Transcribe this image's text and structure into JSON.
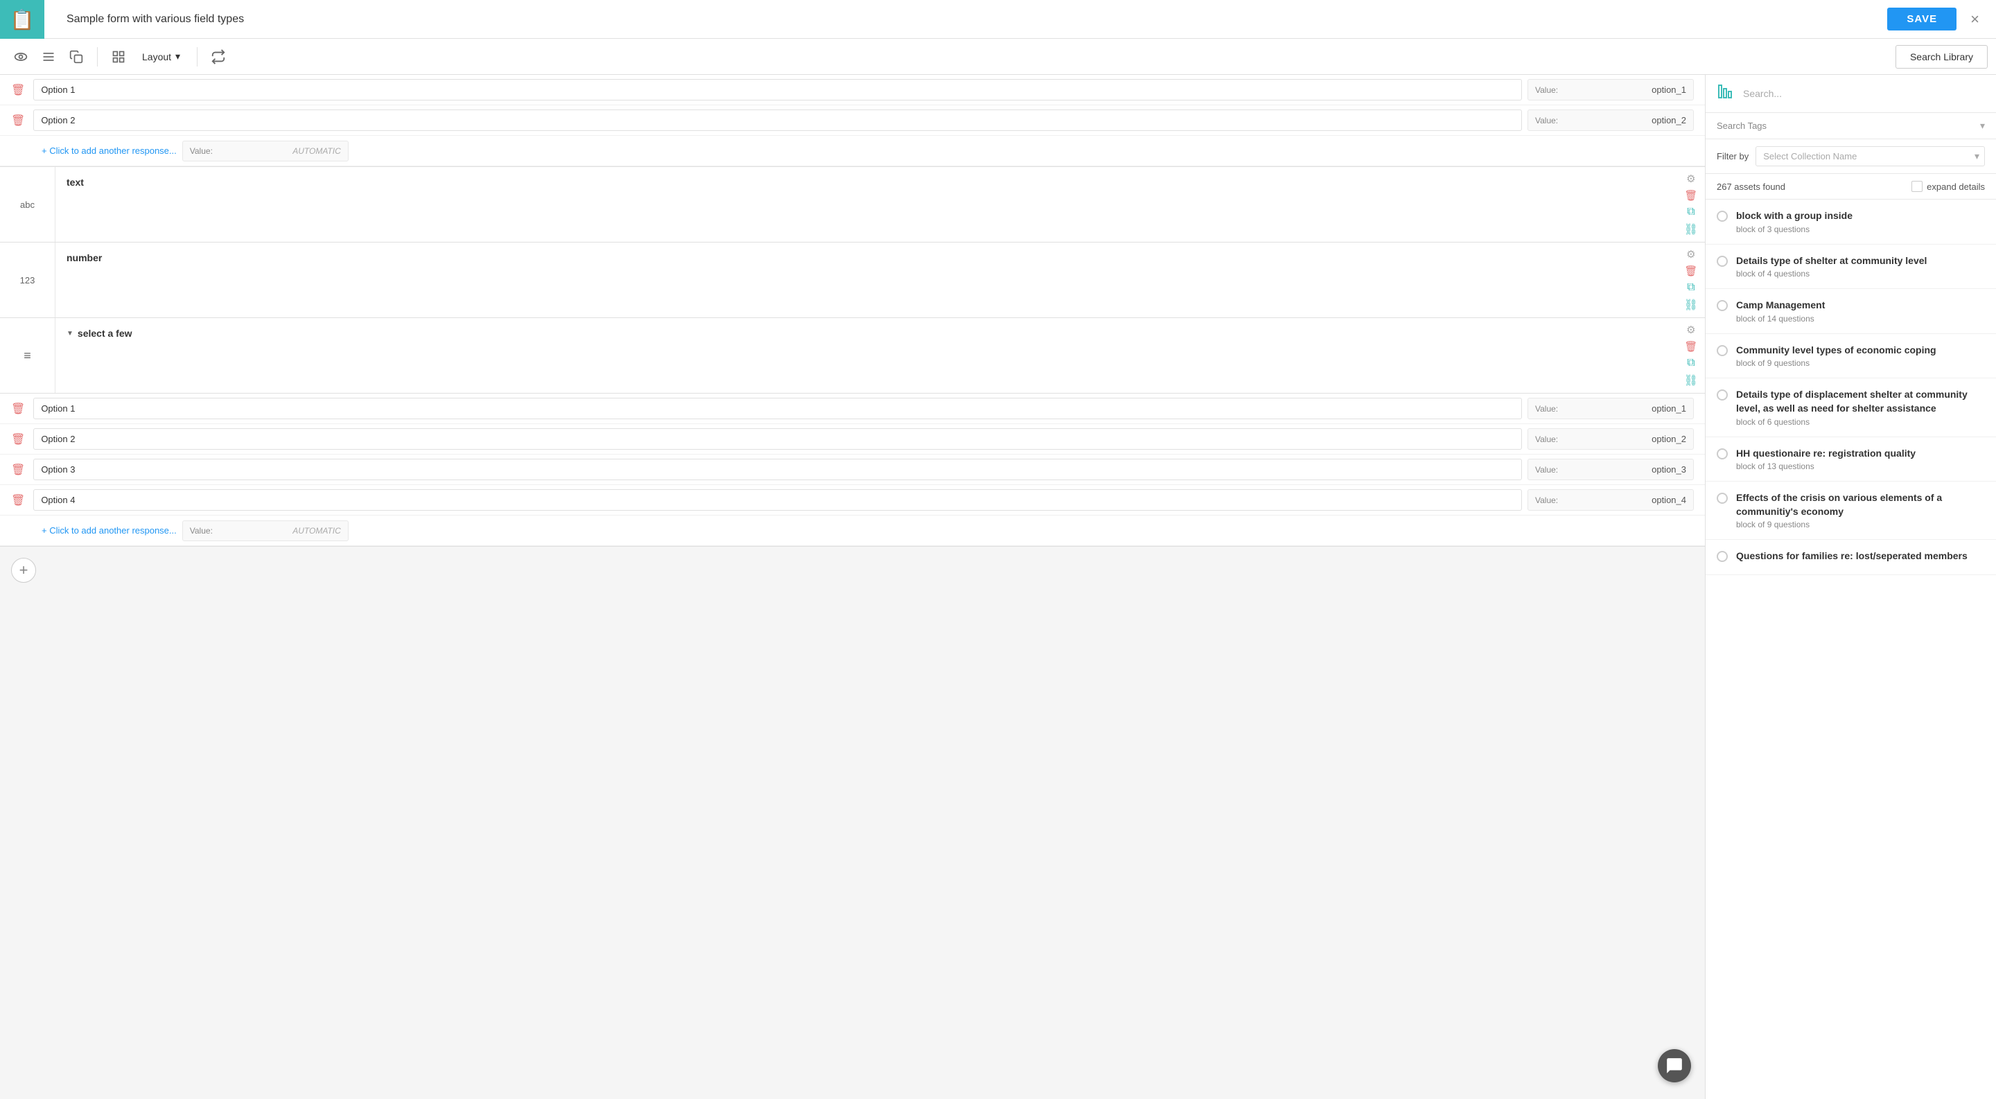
{
  "header": {
    "title": "Sample form with various field types",
    "save_label": "SAVE",
    "close_label": "×"
  },
  "toolbar": {
    "layout_label": "Layout",
    "search_library_label": "Search Library"
  },
  "form": {
    "items": [
      {
        "type": "",
        "label": "",
        "is_options": true,
        "options_section": "top",
        "options": [
          {
            "label": "Option 1",
            "value": "option_1"
          },
          {
            "label": "Option 2",
            "value": "option_2"
          }
        ],
        "add_response": "+ Click to add another response..."
      },
      {
        "type": "abc",
        "label": "text",
        "is_options": false
      },
      {
        "type": "123",
        "label": "number",
        "is_options": false
      },
      {
        "type": "≡",
        "label": "select a few",
        "is_options": false,
        "is_select_few": true
      },
      {
        "type": "",
        "label": "",
        "is_options": true,
        "options_section": "bottom",
        "options": [
          {
            "label": "Option 1",
            "value": "option_1"
          },
          {
            "label": "Option 2",
            "value": "option_2"
          },
          {
            "label": "Option 3",
            "value": "option_3"
          },
          {
            "label": "Option 4",
            "value": "option_4"
          }
        ],
        "add_response": "+ Click to add another response..."
      }
    ],
    "add_button_label": "+"
  },
  "sidebar": {
    "search_placeholder": "Search...",
    "search_tags_label": "Search Tags",
    "filter_label": "Filter by",
    "collection_placeholder": "Select Collection Name",
    "assets_count": "267 assets found",
    "expand_label": "expand details",
    "library_items": [
      {
        "title": "block with a group inside",
        "sub": "block of 3 questions"
      },
      {
        "title": "Details type of shelter at community level",
        "sub": "block of 4 questions"
      },
      {
        "title": "Camp Management",
        "sub": "block of 14 questions"
      },
      {
        "title": "Community level types of economic coping",
        "sub": "block of 9 questions"
      },
      {
        "title": "Details type of displacement shelter at community level, as well as need for shelter assistance",
        "sub": "block of 6 questions"
      },
      {
        "title": "HH questionaire re: registration quality",
        "sub": "block of 13 questions"
      },
      {
        "title": "Effects of the crisis on various elements of a communitiy's economy",
        "sub": "block of 9 questions"
      },
      {
        "title": "Questions for families re: lost/seperated members",
        "sub": ""
      }
    ]
  },
  "icons": {
    "eye": "👁",
    "list": "☰",
    "copy": "⎘",
    "grid": "⊞",
    "arrow": "➤",
    "chevron_down": "▾",
    "gear": "⚙",
    "trash": "🗑",
    "clone": "⧉",
    "link": "⛓",
    "chart": "📊",
    "chat": "💬"
  },
  "colors": {
    "teal": "#3dbcb8",
    "blue": "#2196f3",
    "red": "#e57373",
    "light_bg": "#f9f9f9"
  }
}
